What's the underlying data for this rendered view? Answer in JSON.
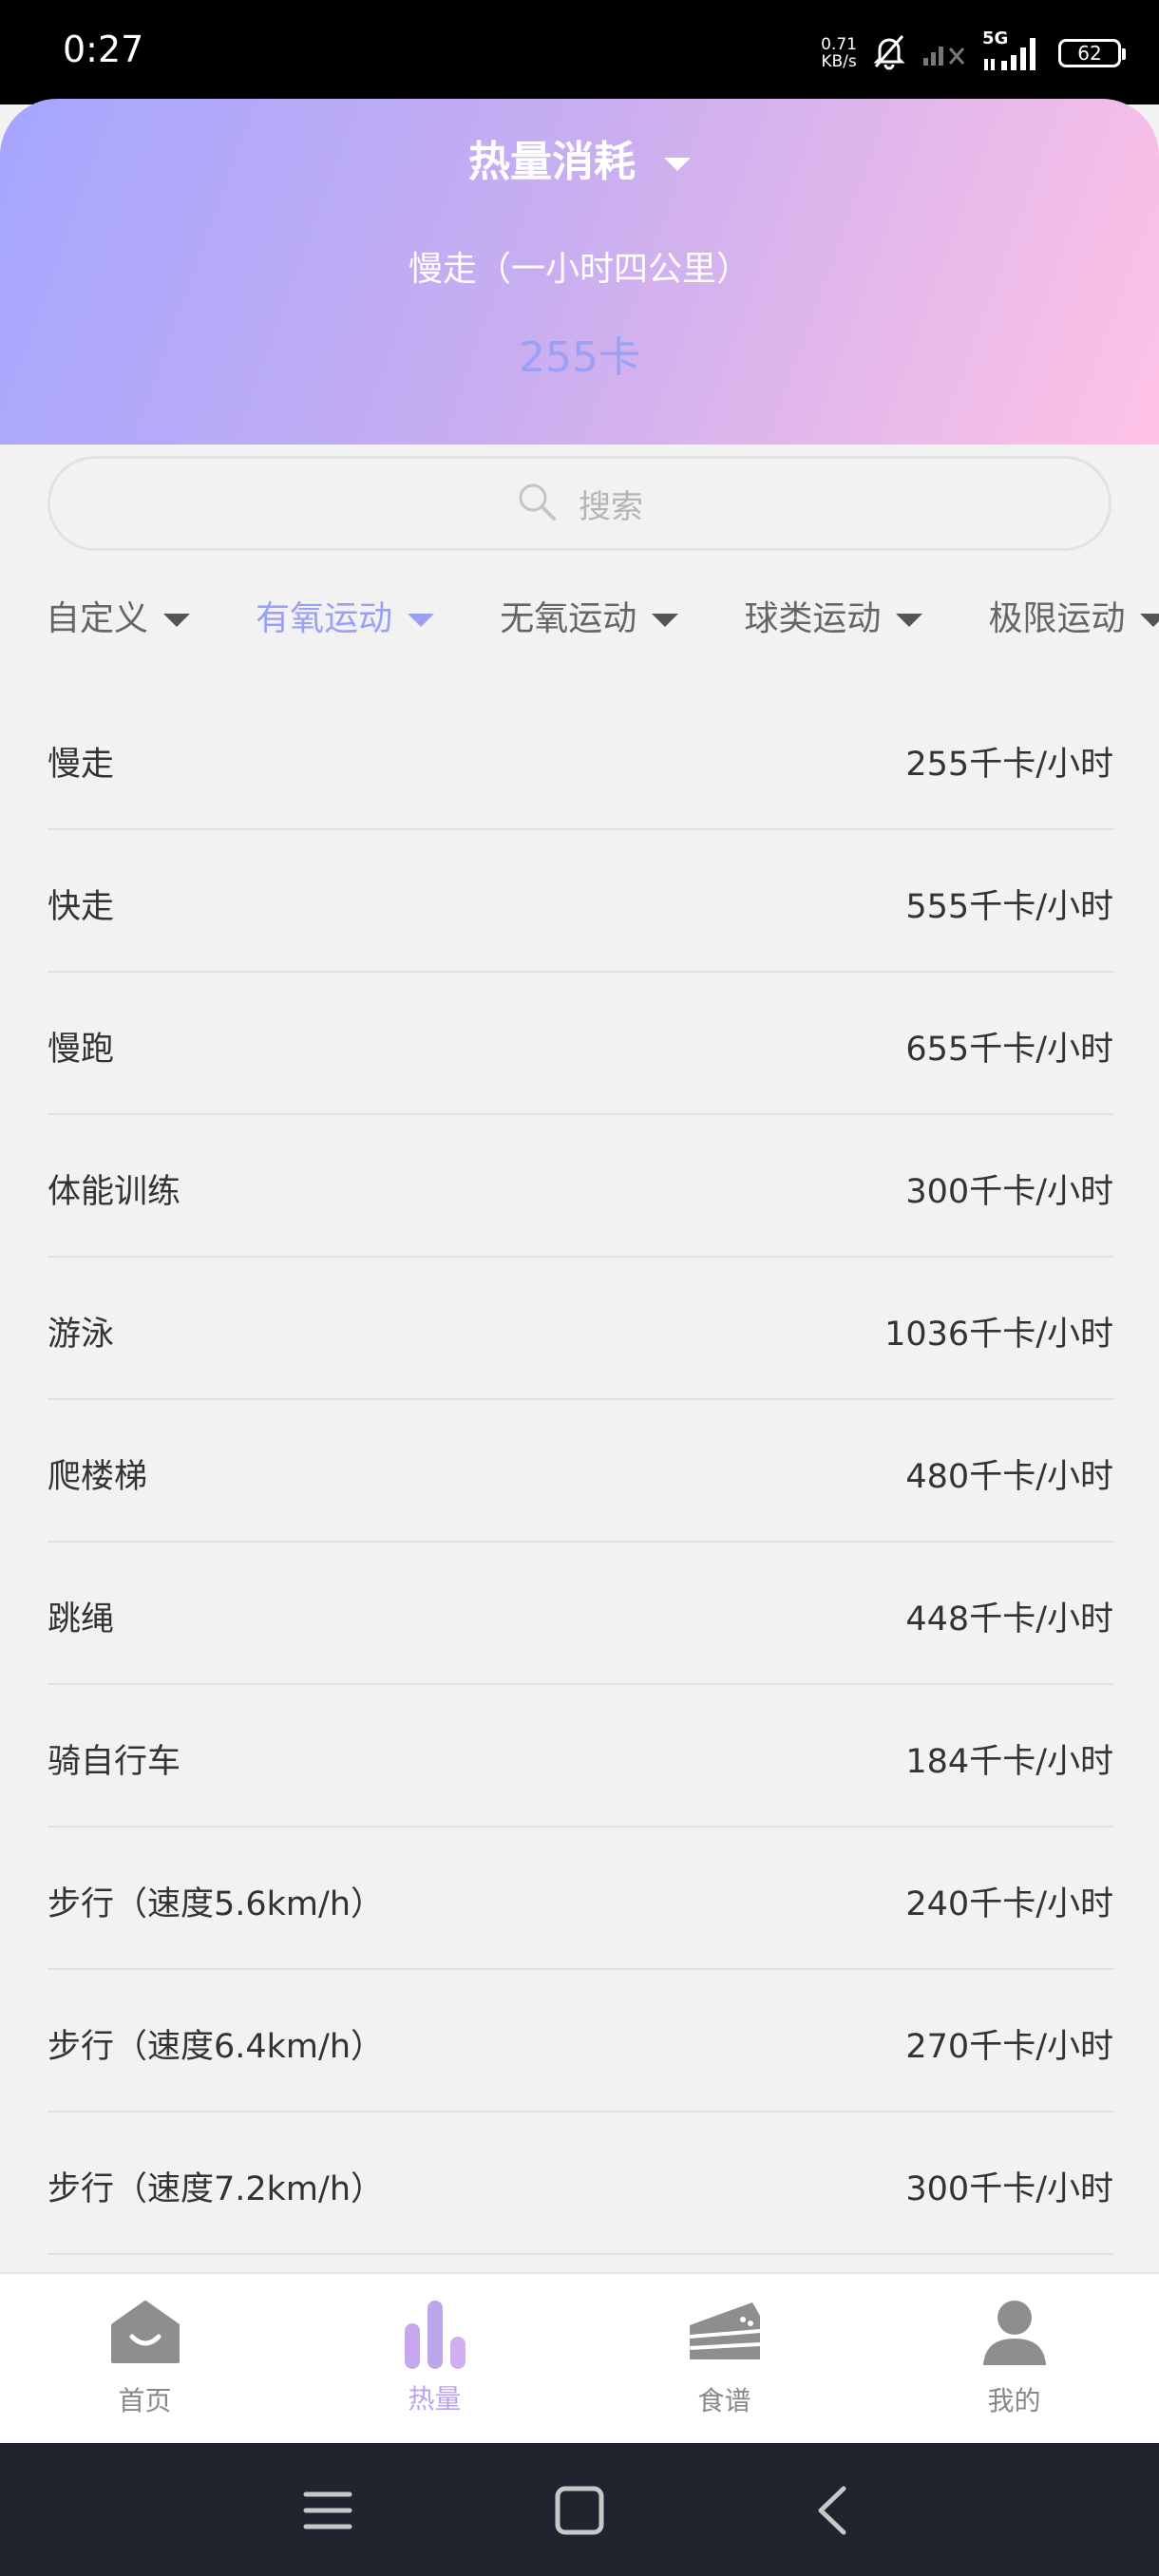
{
  "status_bar": {
    "time": "0:27",
    "net_speed_value": "0.71",
    "net_speed_unit": "KB/s",
    "network_type": "5G",
    "battery": "62"
  },
  "header": {
    "title": "热量消耗",
    "subtitle": "慢走（一小时四公里）",
    "value": "255卡"
  },
  "search": {
    "placeholder": "搜索"
  },
  "categories": [
    {
      "label": "自定义",
      "active": false
    },
    {
      "label": "有氧运动",
      "active": true
    },
    {
      "label": "无氧运动",
      "active": false
    },
    {
      "label": "球类运动",
      "active": false
    },
    {
      "label": "极限运动",
      "active": false
    }
  ],
  "exercises": [
    {
      "name": "慢走",
      "value": "255千卡/小时"
    },
    {
      "name": "快走",
      "value": "555千卡/小时"
    },
    {
      "name": "慢跑",
      "value": "655千卡/小时"
    },
    {
      "name": "体能训练",
      "value": "300千卡/小时"
    },
    {
      "name": "游泳",
      "value": "1036千卡/小时"
    },
    {
      "name": "爬楼梯",
      "value": "480千卡/小时"
    },
    {
      "name": "跳绳",
      "value": "448千卡/小时"
    },
    {
      "name": "骑自行车",
      "value": "184千卡/小时"
    },
    {
      "name": "步行（速度5.6km/h）",
      "value": "240千卡/小时"
    },
    {
      "name": "步行（速度6.4km/h）",
      "value": "270千卡/小时"
    },
    {
      "name": "步行（速度7.2km/h）",
      "value": "300千卡/小时"
    }
  ],
  "tab_bar": [
    {
      "label": "首页",
      "icon": "home-icon",
      "active": false
    },
    {
      "label": "热量",
      "icon": "bar-chart-icon",
      "active": true
    },
    {
      "label": "食谱",
      "icon": "cake-icon",
      "active": false
    },
    {
      "label": "我的",
      "icon": "user-icon",
      "active": false
    }
  ],
  "colors": {
    "accent": "#9aa0f5",
    "header_gradient_start": "#a5a6ff",
    "header_gradient_end": "#ffc2e5",
    "tab_active": "#b9a5ec"
  }
}
